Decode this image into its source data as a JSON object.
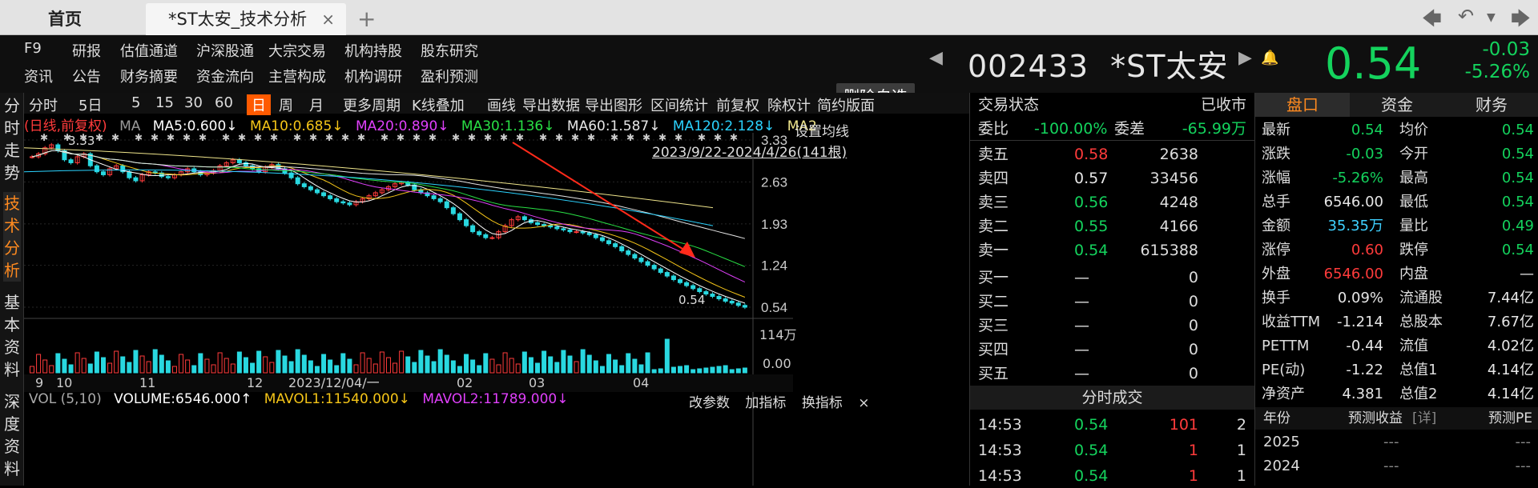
{
  "tabs": {
    "home": "首页",
    "active": "*ST太安_技术分析",
    "close": "×",
    "plus": "+"
  },
  "menu": {
    "row1": [
      "F9",
      "研报",
      "估值通道",
      "沪深股通",
      "大宗交易",
      "机构持股",
      "股东研究"
    ],
    "row2": [
      "资讯",
      "公告",
      "财务摘要",
      "资金流向",
      "主营构成",
      "机构调研",
      "盈利预测"
    ]
  },
  "header": {
    "delete_button": "删除自选",
    "code": "002433",
    "name": "*ST太安",
    "price": "0.54",
    "change": "-0.03",
    "change_pct": "-5.26%"
  },
  "leftnav": [
    [
      "分",
      "时",
      "走",
      "势"
    ],
    [
      "技",
      "术",
      "分",
      "析"
    ],
    [
      "基",
      "本",
      "资",
      "料"
    ],
    [
      "深",
      "度",
      "资",
      "料"
    ]
  ],
  "toolbar": {
    "items": [
      "分时",
      "5日",
      "5",
      "15",
      "30",
      "60",
      "日",
      "周",
      "月",
      "更多周期",
      "K线叠加",
      "画线",
      "导出数据",
      "导出图形",
      "区间统计",
      "前复权",
      "除权计",
      "简约版面"
    ]
  },
  "ma_legend": {
    "mode": "(日线,前复权)",
    "ma": "MA",
    "ma5": "MA5:0.600↓",
    "ma10": "MA10:0.685↓",
    "ma20": "MA20:0.890↓",
    "ma30": "MA30:1.136↓",
    "ma60": "MA60:1.587↓",
    "ma120": "MA120:2.128↓",
    "ma2": "MA2",
    "set_ma": "设置均线",
    "date_range": "2023/9/22-2024/4/26(141根)"
  },
  "chart_data": {
    "type": "candlestick",
    "y_ticks": [
      "3.33",
      "2.63",
      "1.93",
      "1.24",
      "0.54"
    ],
    "ylim": [
      0.54,
      3.33
    ],
    "high_label": "3.33",
    "low_label": "0.54",
    "x_ticks": [
      "9",
      "10",
      "11",
      "12",
      "2023/12/04/一",
      "02",
      "03",
      "04"
    ],
    "closes": [
      3.05,
      3.1,
      3.2,
      3.25,
      3.15,
      3.0,
      2.95,
      3.05,
      3.1,
      2.9,
      2.8,
      2.75,
      2.85,
      2.9,
      2.8,
      2.7,
      2.65,
      2.75,
      2.8,
      2.78,
      2.72,
      2.7,
      2.75,
      2.8,
      2.85,
      2.8,
      2.75,
      2.78,
      2.82,
      2.9,
      2.95,
      3.0,
      2.95,
      2.9,
      2.85,
      2.8,
      2.88,
      2.92,
      2.85,
      2.78,
      2.7,
      2.6,
      2.55,
      2.5,
      2.45,
      2.4,
      2.35,
      2.3,
      2.28,
      2.25,
      2.3,
      2.35,
      2.4,
      2.45,
      2.5,
      2.55,
      2.6,
      2.62,
      2.58,
      2.5,
      2.45,
      2.4,
      2.35,
      2.3,
      2.2,
      2.1,
      2.0,
      1.9,
      1.8,
      1.75,
      1.7,
      1.7,
      1.8,
      1.9,
      2.0,
      2.05,
      2.0,
      1.95,
      1.92,
      1.9,
      1.88,
      1.85,
      1.83,
      1.8,
      1.8,
      1.78,
      1.75,
      1.7,
      1.65,
      1.6,
      1.55,
      1.48,
      1.42,
      1.36,
      1.3,
      1.24,
      1.18,
      1.12,
      1.06,
      1.0,
      0.95,
      0.9,
      0.85,
      0.8,
      0.76,
      0.72,
      0.68,
      0.64,
      0.61,
      0.57,
      0.54
    ],
    "ma_colors": {
      "ma5": "#ffffff",
      "ma10": "#f5c518",
      "ma20": "#e040fb",
      "ma30": "#29e045",
      "ma60": "#e6e6e6",
      "ma120": "#2bd3ff",
      "ma250": "#f0e68c"
    }
  },
  "volume": {
    "legend_title": "VOL (5,10)",
    "volume": "VOLUME:6546.000↑",
    "mavol1": "MAVOL1:11540.000↓",
    "mavol2": "MAVOL2:11789.000↓",
    "y_top": "114万",
    "y_bottom": "0.00",
    "buttons": [
      "改参数",
      "加指标",
      "换指标",
      "×"
    ]
  },
  "orderbook": {
    "title": "交易状态",
    "status": "已收市",
    "webi_label": "委比",
    "webi": "-100.00%",
    "weicha_label": "委差",
    "weicha": "-65.99万",
    "asks": [
      {
        "label": "卖五",
        "price": "0.58",
        "vol": "2638"
      },
      {
        "label": "卖四",
        "price": "0.57",
        "vol": "33456"
      },
      {
        "label": "卖三",
        "price": "0.56",
        "vol": "4248"
      },
      {
        "label": "卖二",
        "price": "0.55",
        "vol": "4166"
      },
      {
        "label": "卖一",
        "price": "0.54",
        "vol": "615388"
      }
    ],
    "bids": [
      {
        "label": "买一",
        "price": "—",
        "vol": "0"
      },
      {
        "label": "买二",
        "price": "—",
        "vol": "0"
      },
      {
        "label": "买三",
        "price": "—",
        "vol": "0"
      },
      {
        "label": "买四",
        "price": "—",
        "vol": "0"
      },
      {
        "label": "买五",
        "price": "—",
        "vol": "0"
      }
    ],
    "ticks_title": "分时成交",
    "ticks": [
      {
        "time": "14:53",
        "price": "0.54",
        "vol": "101",
        "n": "2"
      },
      {
        "time": "14:53",
        "price": "0.54",
        "vol": "1",
        "n": "1"
      },
      {
        "time": "14:53",
        "price": "0.54",
        "vol": "1",
        "n": "1"
      }
    ]
  },
  "panel": {
    "tabs": [
      "盘口",
      "资金",
      "财务"
    ],
    "rows": [
      [
        "最新",
        "0.54",
        "均价",
        "0.54"
      ],
      [
        "涨跌",
        "-0.03",
        "今开",
        "0.54"
      ],
      [
        "涨幅",
        "-5.26%",
        "最高",
        "0.54"
      ],
      [
        "总手",
        "6546.00",
        "最低",
        "0.54"
      ],
      [
        "金额",
        "35.35万",
        "量比",
        "0.49"
      ],
      [
        "涨停",
        "0.60",
        "跌停",
        "0.54"
      ],
      [
        "外盘",
        "6546.00",
        "内盘",
        "—"
      ],
      [
        "换手",
        "0.09%",
        "流通股",
        "7.44亿"
      ],
      [
        "收益TTM",
        "-1.214",
        "总股本",
        "7.67亿"
      ],
      [
        "PETTM",
        "-0.44",
        "流值",
        "4.02亿"
      ],
      [
        "PE(动)",
        "-1.22",
        "总值1",
        "4.14亿"
      ],
      [
        "净资产",
        "4.381",
        "总值2",
        "4.14亿"
      ]
    ],
    "forecast_header": [
      "年份",
      "预测收益",
      "[详]",
      "预测PE"
    ],
    "forecast": [
      [
        "2025",
        "---",
        "---"
      ],
      [
        "2024",
        "---",
        "---"
      ]
    ]
  }
}
